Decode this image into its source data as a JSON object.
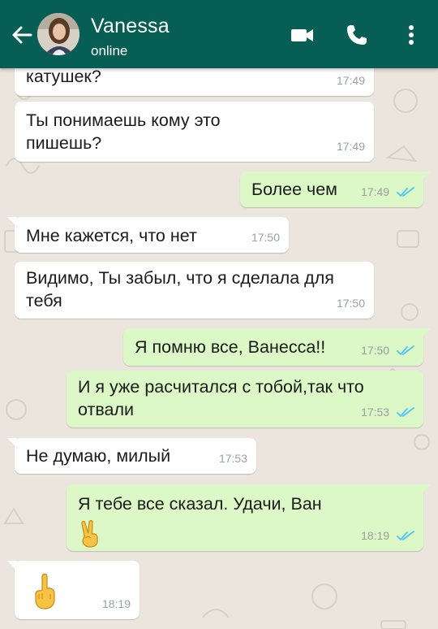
{
  "header": {
    "contact_name": "Vanessa",
    "status": "online",
    "bg_color": "#075e54",
    "icons": {
      "back": "arrow-left-icon",
      "video": "video-camera-icon",
      "call": "phone-icon",
      "menu": "more-vertical-icon"
    }
  },
  "messages": [
    {
      "direction": "incoming",
      "text": "катушек?",
      "time": "17:49"
    },
    {
      "direction": "incoming",
      "text": "Ты понимаешь кому это\nпишешь?",
      "time": "17:49"
    },
    {
      "direction": "outgoing",
      "text": "Более чем",
      "time": "17:49",
      "status": "read"
    },
    {
      "direction": "incoming",
      "text": "Мне кажется, что нет",
      "time": "17:50"
    },
    {
      "direction": "incoming",
      "text": "Видимо, Ты забыл, что я сделала для\nтебя",
      "time": "17:50"
    },
    {
      "direction": "outgoing",
      "text": "Я помню все, Ванесса!!",
      "time": "17:50",
      "status": "read"
    },
    {
      "direction": "outgoing",
      "text": "И я уже расчитался с тобой,так что\nотвали",
      "time": "17:53",
      "status": "read"
    },
    {
      "direction": "incoming",
      "text": "Не думаю, милый",
      "time": "17:53"
    },
    {
      "direction": "outgoing",
      "text": "Я тебе все сказал. Удачи, Ван",
      "emoji": "victory-hand-emoji",
      "time": "18:19",
      "status": "read"
    },
    {
      "direction": "incoming",
      "emoji": "middle-finger-emoji",
      "time": "18:19"
    }
  ],
  "colors": {
    "incoming_bubble": "#ffffff",
    "outgoing_bubble": "#dcf8c6",
    "read_ticks": "#4fc3f7",
    "chat_background": "#ece5dd"
  }
}
